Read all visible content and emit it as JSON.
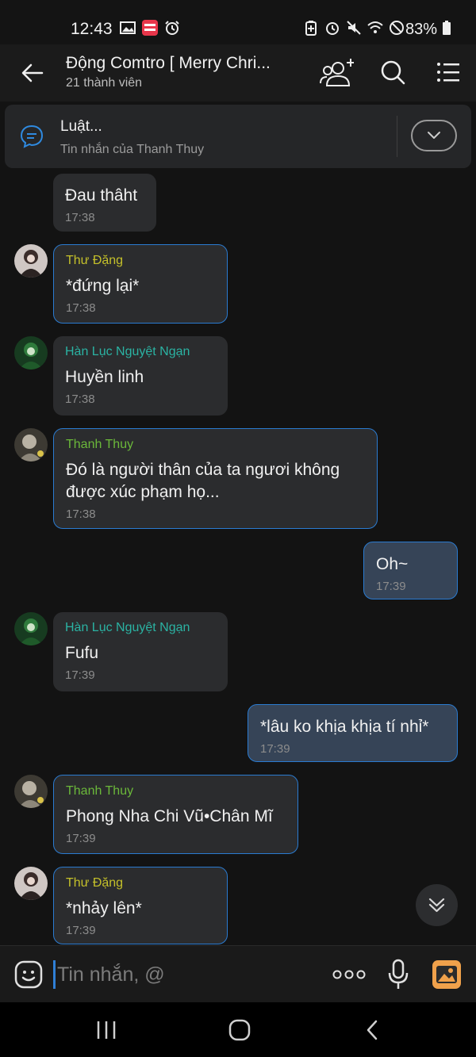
{
  "status_bar": {
    "time": "12:43",
    "battery": "83%"
  },
  "header": {
    "title": "Động Comtro [ Merry Chri...",
    "subtitle": "21 thành viên"
  },
  "pinned": {
    "title": "Luật...",
    "subtitle": "Tin nhắn của Thanh Thuy"
  },
  "messages": [
    {
      "sender": "",
      "text": "Đau thâht",
      "time": "17:38",
      "mine": false
    },
    {
      "sender": "Thư Đặng",
      "text": "*đứng lại*",
      "time": "17:38",
      "mine": false
    },
    {
      "sender": "Hàn Lục Nguyệt Ngạn",
      "text": "Huyền linh",
      "time": "17:38",
      "mine": false
    },
    {
      "sender": "Thanh Thuy",
      "text": "Đó là người thân của ta ngươi không được xúc phạm họ...",
      "time": "17:38",
      "mine": false
    },
    {
      "sender": "",
      "text": "Oh~",
      "time": "17:39",
      "mine": true
    },
    {
      "sender": "Hàn Lục Nguyệt Ngạn",
      "text": "Fufu",
      "time": "17:39",
      "mine": false
    },
    {
      "sender": "",
      "text": "*lâu ko khịa khịa tí nhỉ*",
      "time": "17:39",
      "mine": true
    },
    {
      "sender": "Thanh Thuy",
      "text": "Phong Nha Chi Vũ•Chân Mĩ",
      "time": "17:39",
      "mine": false
    },
    {
      "sender": "Thư Đặng",
      "text": "*nhảy lên*",
      "time": "17:39",
      "mine": false
    }
  ],
  "colors": {
    "name_thu_dang": "#c4c02a",
    "name_han_luc": "#2bb3a3",
    "name_thanh_thuy": "#6bb83a",
    "accent": "#2a7bd1",
    "mine_bubble": "#364457"
  },
  "input": {
    "placeholder": "Tin nhắn, @"
  },
  "icons": {
    "back": "arrow-left-icon",
    "add_member": "add-member-icon",
    "search": "search-icon",
    "menu": "menu-icon",
    "pinned": "chat-bubble-icon",
    "expand": "chevron-down-icon",
    "emoji": "emoji-icon",
    "more": "more-dots-icon",
    "mic": "microphone-icon",
    "gallery": "gallery-icon",
    "scroll_down": "double-chevron-down-icon"
  }
}
